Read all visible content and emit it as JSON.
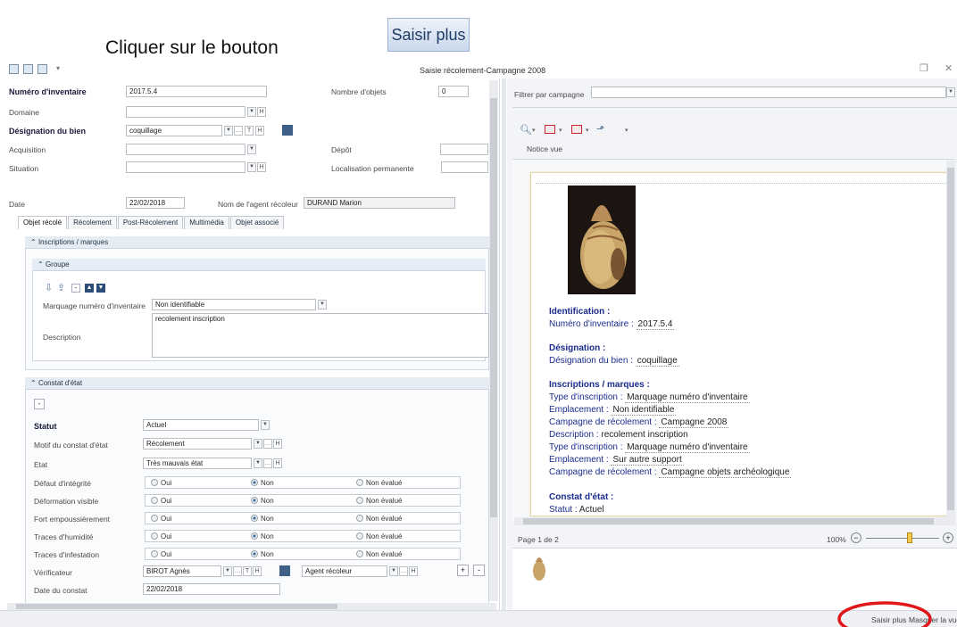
{
  "caption": {
    "text": "Cliquer sur le bouton",
    "button_label": "Saisir plus"
  },
  "window": {
    "title": "Saisie récolement-Campagne 2008"
  },
  "form": {
    "numero_label": "Numéro d'inventaire",
    "numero_value": "2017.5.4",
    "nombre_label": "Nombre d'objets",
    "nombre_value": "0",
    "domaine_label": "Domaine",
    "designation_label": "Désignation du bien",
    "designation_value": "coquillage",
    "acquisition_label": "Acquisition",
    "depot_label": "Dépôt",
    "situation_label": "Situation",
    "localisation_label": "Localisation permanente",
    "date_label": "Date",
    "date_value": "22/02/2018",
    "agent_label": "Nom de l'agent récoleur",
    "agent_value": "DURAND Marion"
  },
  "tabs": [
    "Objet récolé",
    "Récolement",
    "Post-Récolement",
    "Multimédia",
    "Objet associé"
  ],
  "inscriptions": {
    "header": "Inscriptions / marques",
    "groupe": "Groupe",
    "marquage_label": "Marquage numéro d'inventaire",
    "marquage_value": "Non identifiable",
    "description_label": "Description",
    "description_value": "recolement inscription"
  },
  "constat": {
    "header": "Constat d'état",
    "statut_label": "Statut",
    "statut_value": "Actuel",
    "motif_label": "Motif du constat d'état",
    "motif_value": "Récolement",
    "etat_label": "Etat",
    "etat_value": "Très mauvais état",
    "rows": [
      {
        "label": "Défaut d'intégrité",
        "selected": "Non"
      },
      {
        "label": "Déformation visible",
        "selected": "Non"
      },
      {
        "label": "Fort empoussièrement",
        "selected": "Non"
      },
      {
        "label": "Traces d'humidité",
        "selected": "Non"
      },
      {
        "label": "Traces d'infestation",
        "selected": "Non"
      }
    ],
    "opt_oui": "Oui",
    "opt_non": "Non",
    "opt_nonevalue": "Non évalué",
    "verificateur_label": "Vérificateur",
    "verificateur_value": "BIROT Agnès",
    "agent_recoleur_value": "Agent récoleur",
    "date_constat_label": "Date du constat",
    "date_constat_value": "22/02/2018",
    "plus": "+",
    "minus": "-"
  },
  "right": {
    "filtre_label": "Filtrer par campagne",
    "notice_vue": "Notice vue",
    "page_info": "Page 1 de 2",
    "zoom": "100%",
    "zoom_level": 0.6
  },
  "preview": {
    "identification_title": "Identification :",
    "numero_label": "Numéro d'inventaire :",
    "numero_value": "2017.5.4",
    "designation_title": "Désignation :",
    "designation_label": "Désignation du bien :",
    "designation_value": "coquillage",
    "inscriptions_title": "Inscriptions / marques :",
    "type1_label": "Type d'inscription :",
    "type1_value": "Marquage numéro d'inventaire",
    "empl1_label": "Emplacement :",
    "empl1_value": "Non identifiable",
    "camp1_label": "Campagne de récolement :",
    "camp1_value": "Campagne 2008",
    "desc_label": "Description :",
    "desc_value": "recolement inscription",
    "type2_label": "Type d'inscription :",
    "type2_value": "Marquage numéro d'inventaire",
    "empl2_label": "Emplacement :",
    "empl2_value": "Sur autre support",
    "camp2_label": "Campagne de récolement :",
    "camp2_value": "Campagne objets archéologique",
    "constat_title": "Constat d'état :",
    "statut_label": "Statut :",
    "statut_value": "Actuel"
  },
  "status": {
    "saisir_plus": "Saisir plus",
    "masquer": "Masquer la vue"
  },
  "colors": {
    "highlight_ellipse": "#e0161b",
    "link_blue": "#1a2b8c"
  }
}
